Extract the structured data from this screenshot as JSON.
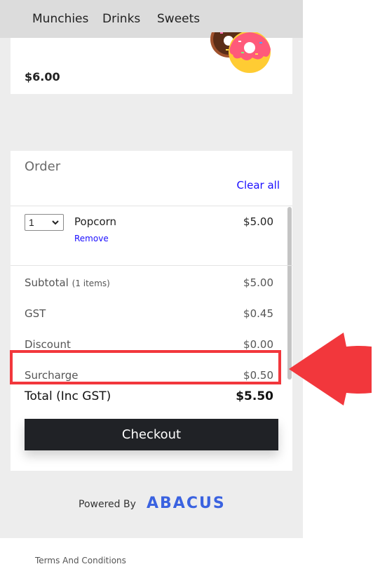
{
  "nav": {
    "tabs": [
      {
        "label": "Munchies"
      },
      {
        "label": "Drinks"
      },
      {
        "label": "Sweets"
      }
    ],
    "active_tab": "Sweets"
  },
  "product": {
    "price": "$6.00",
    "image_icon": "donut-icon"
  },
  "order": {
    "title": "Order",
    "clear_all_label": "Clear all",
    "items": [
      {
        "quantity": "1",
        "name": "Popcorn",
        "remove_label": "Remove",
        "price": "$5.00"
      }
    ],
    "summary": {
      "subtotal_label": "Subtotal",
      "subtotal_count": "(1 items)",
      "subtotal_value": "$5.00",
      "gst_label": "GST",
      "gst_value": "$0.45",
      "discount_label": "Discount",
      "discount_value": "$0.00",
      "surcharge_label": "Surcharge",
      "surcharge_value": "$0.50",
      "total_label": "Total (Inc GST)",
      "total_value": "$5.50"
    },
    "checkout_label": "Checkout"
  },
  "footer": {
    "powered_by": "Powered By",
    "brand": "ABACUS",
    "terms_label": "Terms And Conditions"
  },
  "colors": {
    "link": "#1a0dff",
    "brand": "#3a62e0",
    "checkout_bg": "#202226",
    "annotation": "#f2373c"
  }
}
